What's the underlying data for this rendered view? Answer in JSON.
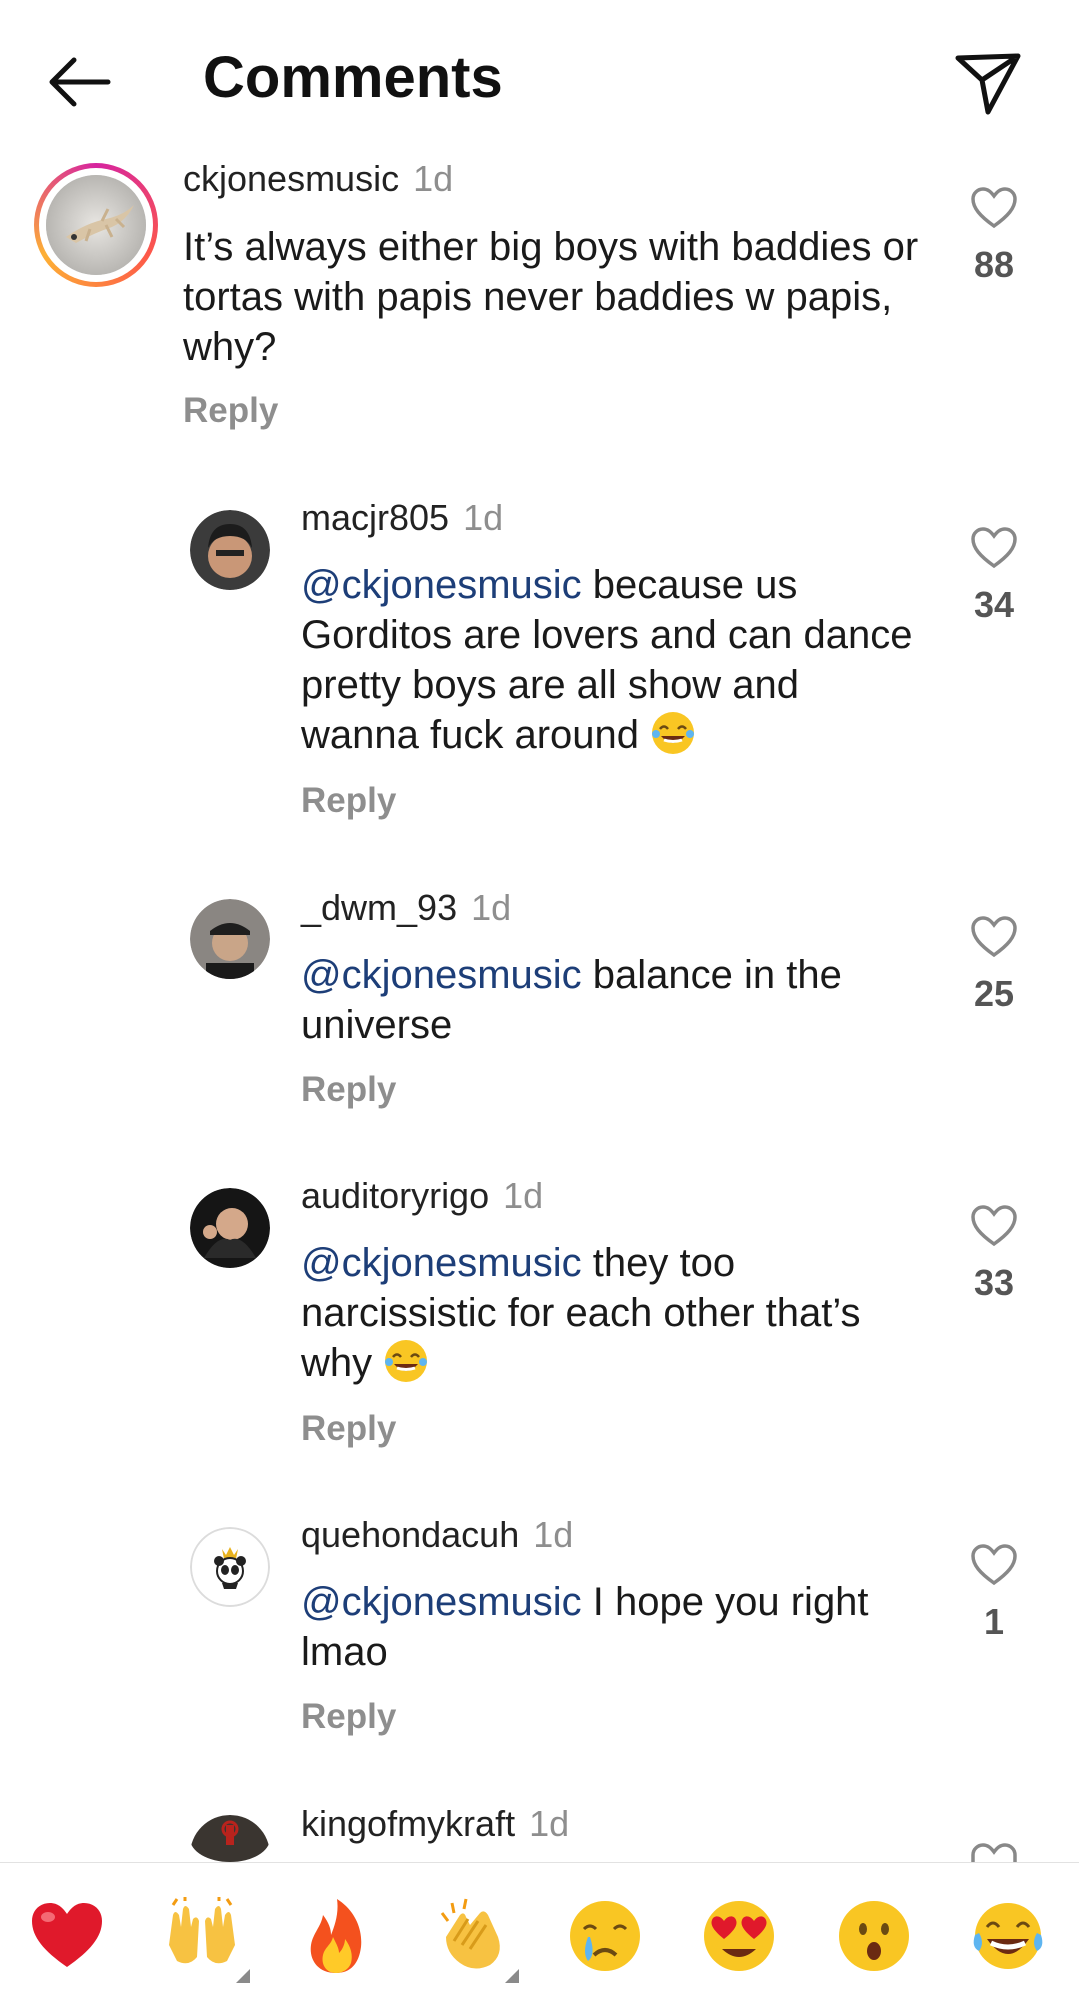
{
  "header": {
    "title": "Comments"
  },
  "comments": [
    {
      "username": "ckjonesmusic",
      "time": "1d",
      "text": "It’s always either big boys with baddies or tortas with papis never baddies w papis, why?",
      "likes": "88",
      "reply": "Reply"
    },
    {
      "username": "macjr805",
      "time": "1d",
      "mention": "@ckjonesmusic",
      "text": " because us Gorditos are lovers and can dance pretty boys are all show and wanna fuck around ",
      "likes": "34",
      "reply": "Reply"
    },
    {
      "username": "_dwm_93",
      "time": "1d",
      "mention": "@ckjonesmusic",
      "text": " balance in the universe",
      "likes": "25",
      "reply": "Reply"
    },
    {
      "username": "auditoryrigo",
      "time": "1d",
      "mention": "@ckjonesmusic",
      "text": " they too narcissistic for each other that’s why ",
      "likes": "33",
      "reply": "Reply"
    },
    {
      "username": "quehondacuh",
      "time": "1d",
      "mention": "@ckjonesmusic",
      "text": " I hope you right lmao",
      "likes": "1",
      "reply": "Reply"
    },
    {
      "username": "kingofmykraft",
      "time": "1d"
    }
  ],
  "quick_reactions": [
    "red-heart",
    "raising-hands",
    "fire",
    "clapping-hands",
    "crying-face",
    "heart-eyes",
    "surprised-face",
    "tears-of-joy"
  ],
  "colors": {
    "mention": "#1d3e78",
    "muted": "#8e8e8e",
    "heart": "#e0192b"
  }
}
